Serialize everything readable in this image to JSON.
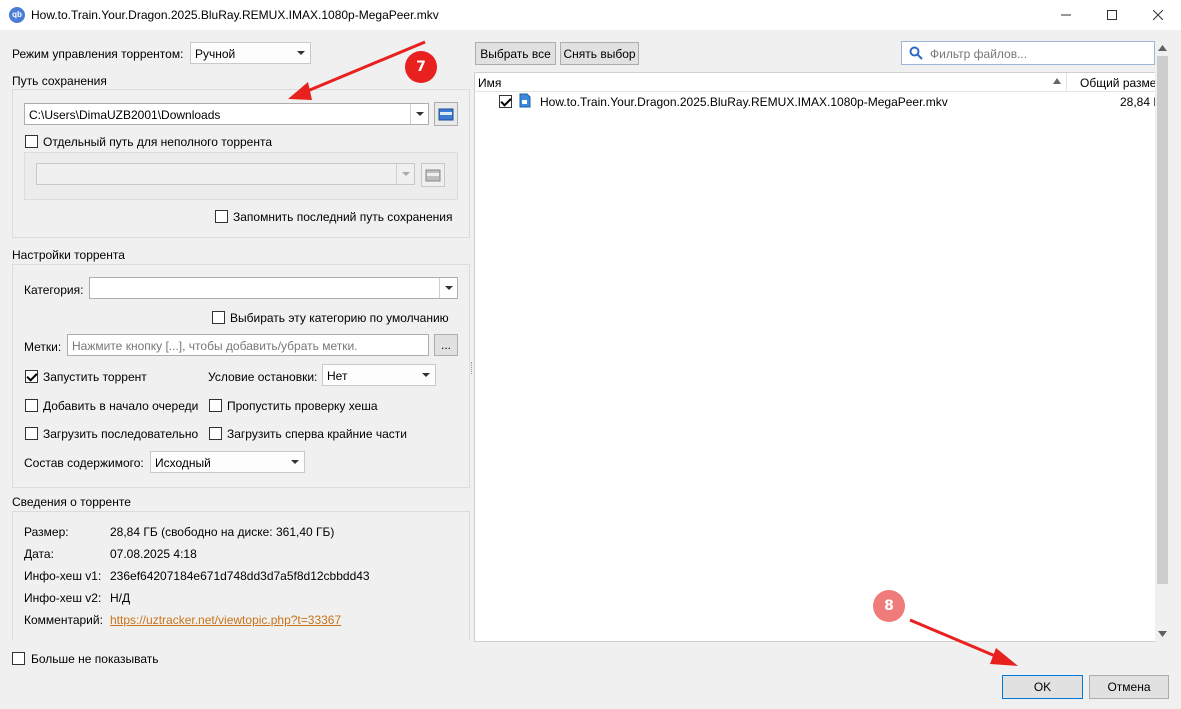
{
  "window": {
    "title": "How.to.Train.Your.Dragon.2025.BluRay.REMUX.IMAX.1080p-MegaPeer.mkv",
    "app_icon_text": "qb"
  },
  "left": {
    "mode_label": "Режим управления торрентом:",
    "mode_value": "Ручной",
    "save_path_group": "Путь сохранения",
    "save_path_value": "C:\\Users\\DimaUZB2001\\Downloads",
    "separate_path_label": "Отдельный путь для неполного торрента",
    "remember_path_label": "Запомнить последний путь сохранения",
    "torrent_settings_group": "Настройки торрента",
    "category_label": "Категория:",
    "category_value": "",
    "default_category_label": "Выбирать эту категорию по умолчанию",
    "tags_label": "Метки:",
    "tags_placeholder": "Нажмите кнопку [...], чтобы добавить/убрать метки.",
    "tags_button": "...",
    "start_torrent_label": "Запустить торрент",
    "stop_condition_label": "Условие остановки:",
    "stop_condition_value": "Нет",
    "add_top_queue_label": "Добавить в начало очереди",
    "skip_hash_label": "Пропустить проверку хеша",
    "sequential_label": "Загрузить последовательно",
    "first_last_label": "Загрузить сперва крайние части",
    "content_layout_label": "Состав содержимого:",
    "content_layout_value": "Исходный",
    "info_group": "Сведения о торренте",
    "info": {
      "size_key": "Размер:",
      "size_val": "28,84 ГБ (свободно на диске: 361,40 ГБ)",
      "date_key": "Дата:",
      "date_val": "07.08.2025 4:18",
      "hash1_key": "Инфо-хеш v1:",
      "hash1_val": "236ef64207184e671d748dd3d7a5f8d12cbbdd43",
      "hash2_key": "Инфо-хеш v2:",
      "hash2_val": "Н/Д",
      "comment_key": "Комментарий:",
      "comment_val": "https://uztracker.net/viewtopic.php?t=33367"
    },
    "dont_show_label": "Больше не показывать"
  },
  "right": {
    "select_all": "Выбрать все",
    "select_none": "Снять выбор",
    "filter_placeholder": "Фильтр файлов...",
    "col_name": "Имя",
    "col_size": "Общий разме",
    "file_name": "How.to.Train.Your.Dragon.2025.BluRay.REMUX.IMAX.1080p-MegaPeer.mkv",
    "file_size": "28,84 Г"
  },
  "buttons": {
    "ok": "OK",
    "cancel": "Отмена"
  },
  "annotations": {
    "badge7": "7",
    "badge8": "8",
    "color": "#e8211f",
    "badge_color": "#f07b7b"
  }
}
